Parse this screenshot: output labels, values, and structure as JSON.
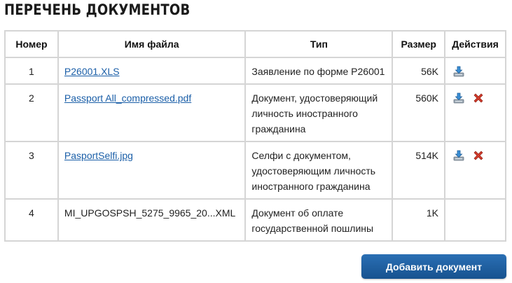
{
  "page": {
    "title": "ПЕРЕЧЕНЬ ДОКУМЕНТОВ"
  },
  "table": {
    "headers": {
      "number": "Номер",
      "filename": "Имя файла",
      "type": "Тип",
      "size": "Размер",
      "actions": "Действия"
    },
    "rows": [
      {
        "number": "1",
        "filename": "P26001.XLS",
        "type": "Заявление по форме Р26001",
        "size": "56K",
        "can_download": true,
        "can_delete": false
      },
      {
        "number": "2",
        "filename": "Passport All_compressed.pdf",
        "type": "Документ, удостоверяющий личность иностранного гражданина",
        "size": "560K",
        "can_download": true,
        "can_delete": true
      },
      {
        "number": "3",
        "filename": "PasportSelfi.jpg",
        "type": "Селфи с документом, удостоверяющим личность иностранного гражданина",
        "size": "514K",
        "can_download": true,
        "can_delete": true
      },
      {
        "number": "4",
        "filename": "MI_UPGOSPSH_5275_9965_20...XML",
        "type": "Документ об оплате государственной пошлины",
        "size": "1K",
        "can_download": false,
        "can_delete": false
      }
    ]
  },
  "actions": {
    "add_document_label": "Добавить документ"
  },
  "colors": {
    "link": "#1b5fa8",
    "button": "#1d5fa3",
    "delete_icon": "#c0392b",
    "border": "#d5d5d5"
  },
  "icons": {
    "download": "download-icon",
    "delete": "delete-icon"
  }
}
